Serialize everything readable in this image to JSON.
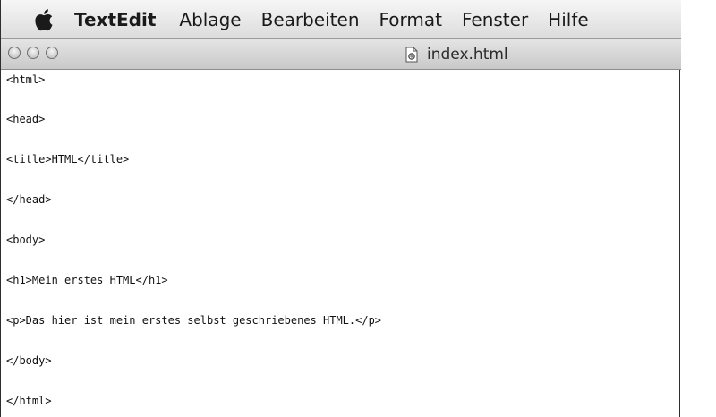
{
  "menubar": {
    "apple_icon": "apple-logo-icon",
    "app_name": "TextEdit",
    "items": [
      "Ablage",
      "Bearbeiten",
      "Format",
      "Fenster",
      "Hilfe"
    ]
  },
  "window": {
    "title": "index.html",
    "title_icon": "html-document-icon",
    "buttons": [
      "close-icon",
      "minimize-icon",
      "zoom-icon"
    ]
  },
  "document": {
    "lines": [
      "<html>",
      "",
      "<head>",
      "",
      "<title>HTML</title>",
      "",
      "</head>",
      "",
      "<body>",
      "",
      "<h1>Mein erstes HTML</h1>",
      "",
      "<p>Das hier ist mein erstes selbst geschriebenes HTML.</p>",
      "",
      "</body>",
      "",
      "</html>"
    ]
  },
  "colors": {
    "menubar_bg": "#e8e8e8",
    "titlebar_bg": "#d6d6d6",
    "text": "#111111"
  }
}
